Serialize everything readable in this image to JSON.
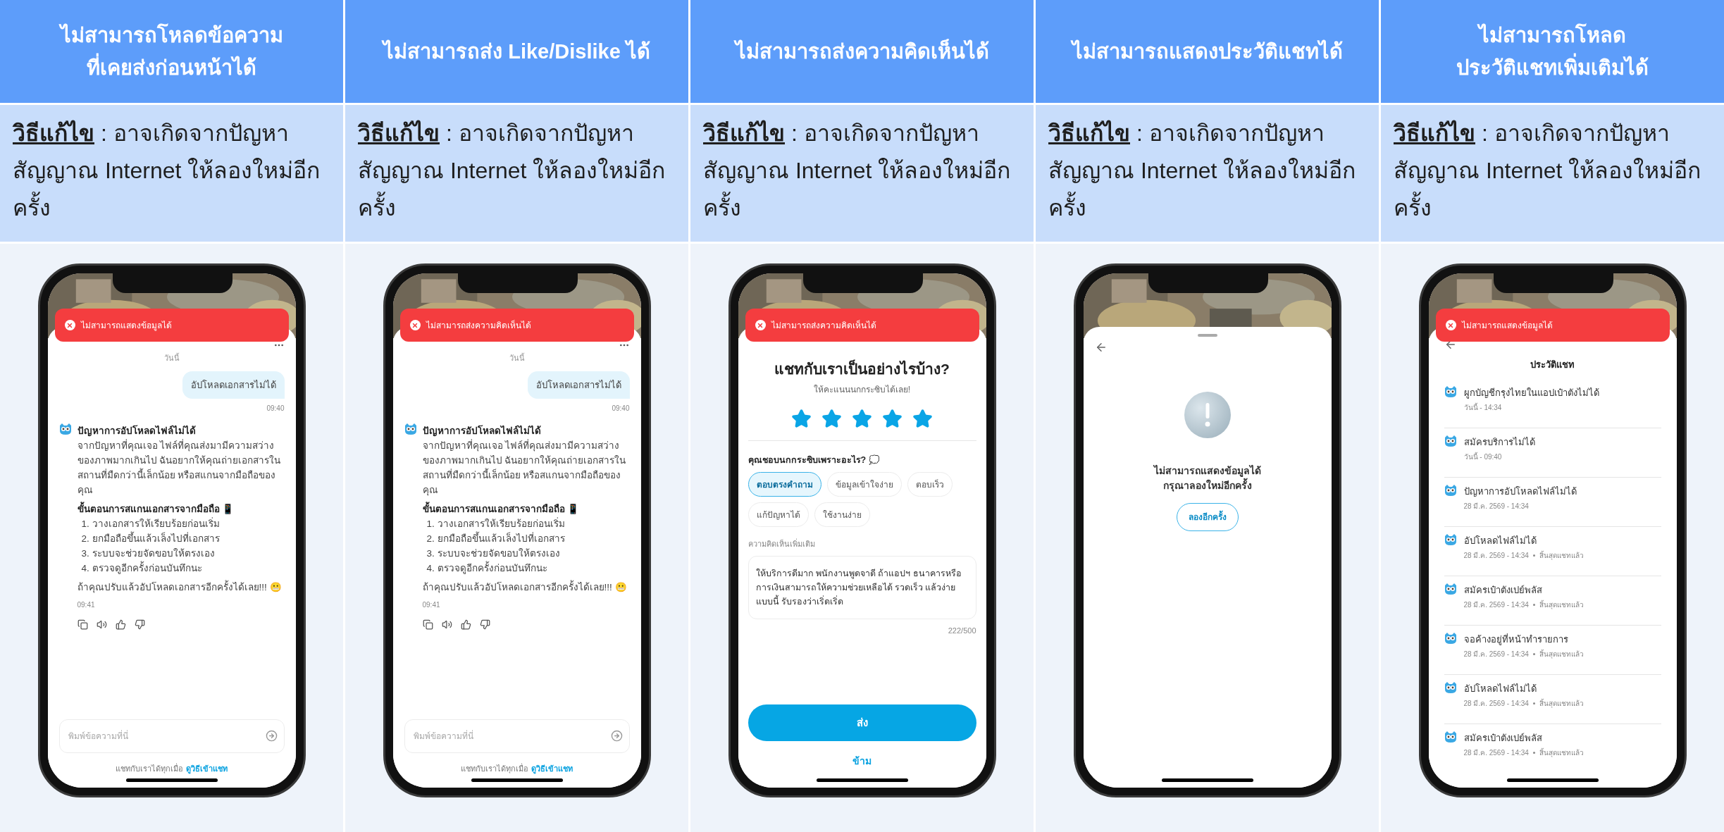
{
  "columns": [
    {
      "title": [
        "ไม่สามารถโหลดข้อความ",
        "ที่เคยส่งก่อนหน้าได้"
      ],
      "fix": {
        "label": "วิธีแก้ไข",
        "text": " : อาจเกิดจากปัญหาสัญญาณ Internet ให้ลองใหม่อีกครั้ง"
      },
      "phone": {
        "kind": "chat",
        "toast": "ไม่สามารถแสดงข้อมูลได้",
        "date": "วันนี้",
        "user_message": "อัปโหลดเอกสารไม่ได้",
        "user_time": "09:40",
        "bot_title": "ปัญหาการอัปโหลดไฟล์ไม่ได้",
        "bot_body": "จากปัญหาที่คุณเจอ ไฟล์ที่คุณส่งมามีความสว่างของภาพมากเกินไป ฉันอยากให้คุณถ่ายเอกสารในสถานที่มืดกว่านี้เล็กน้อย หรือสแกนจากมือถือของคุณ",
        "steps_title": "ขั้นตอนการสแกนเอกสารจากมือถือ 📱",
        "steps": [
          "1. วางเอกสารให้เรียบร้อยก่อนเริ่ม",
          "2. ยกมือถือขึ้นแล้วเล็งไปที่เอกสาร",
          "3. ระบบจะช่วยจัดขอบให้ตรงเอง",
          "4. ตรวจดูอีกครั้งก่อนบันทึกนะ"
        ],
        "closing": "ถ้าคุณปรับแล้วอัปโหลดเอกสารอีกครั้งได้เลย!!! 😬",
        "bot_time": "09:41",
        "input": {
          "placeholder": "พิมพ์ข้อความที่นี่"
        },
        "footer": "แชทกับเราได้ทุกเมื่อ",
        "footer_link": "ดูวิธีเข้าแชท"
      }
    },
    {
      "title": [
        "ไม่สามารถส่ง Like/Dislike ได้"
      ],
      "fix": {
        "label": "วิธีแก้ไข",
        "text": " : อาจเกิดจากปัญหาสัญญาณ Internet ให้ลองใหม่อีกครั้ง"
      },
      "phone": {
        "kind": "chat",
        "toast": "ไม่สามารถส่งความคิดเห็นได้",
        "date": "วันนี้",
        "user_message": "อัปโหลดเอกสารไม่ได้",
        "user_time": "09:40",
        "bot_title": "ปัญหาการอัปโหลดไฟล์ไม่ได้",
        "bot_body": "จากปัญหาที่คุณเจอ ไฟล์ที่คุณส่งมามีความสว่างของภาพมากเกินไป ฉันอยากให้คุณถ่ายเอกสารในสถานที่มืดกว่านี้เล็กน้อย หรือสแกนจากมือถือของคุณ",
        "steps_title": "ขั้นตอนการสแกนเอกสารจากมือถือ 📱",
        "steps": [
          "1. วางเอกสารให้เรียบร้อยก่อนเริ่ม",
          "2. ยกมือถือขึ้นแล้วเล็งไปที่เอกสาร",
          "3. ระบบจะช่วยจัดขอบให้ตรงเอง",
          "4. ตรวจดูอีกครั้งก่อนบันทึกนะ"
        ],
        "closing": "ถ้าคุณปรับแล้วอัปโหลดเอกสารอีกครั้งได้เลย!!! 😬",
        "bot_time": "09:41",
        "input": {
          "placeholder": "พิมพ์ข้อความที่นี่"
        },
        "footer": "แชทกับเราได้ทุกเมื่อ",
        "footer_link": "ดูวิธีเข้าแชท"
      }
    },
    {
      "title": [
        "ไม่สามารถส่งความคิดเห็นได้"
      ],
      "fix": {
        "label": "วิธีแก้ไข",
        "text": " : อาจเกิดจากปัญหาสัญญาณ Internet ให้ลองใหม่อีกครั้ง"
      },
      "phone": {
        "kind": "feedback",
        "toast": "ไม่สามารถส่งความคิดเห็นได้",
        "heading": "แชทกับเราเป็นอย่างไรบ้าง?",
        "subheading": "ให้คะแนนนกกระซิบได้เลย!",
        "stars": 5,
        "question": "คุณชอบนกกระซิบเพราะอะไร? 💭",
        "chips": [
          {
            "label": "ตอบตรงคำถาม",
            "selected": true
          },
          {
            "label": "ข้อมูลเข้าใจง่าย",
            "selected": false
          },
          {
            "label": "ตอบเร็ว",
            "selected": false
          },
          {
            "label": "แก้ปัญหาได้",
            "selected": false
          },
          {
            "label": "ใช้งานง่าย",
            "selected": false
          }
        ],
        "comment_label": "ความคิดเห็นเพิ่มเติม",
        "comment": "ให้บริการดีมาก พนักงานพูดจาดี ถ้าแอปฯ ธนาคารหรือการเงินสามารถให้ความช่วยเหลือได้ รวดเร็ว แล้วง่ายแบบนี้ รับรองว่าเริ่ดเริ่ด",
        "counter": "222/500",
        "submit": "ส่ง",
        "skip": "ข้าม"
      }
    },
    {
      "title": [
        "ไม่สามารถแสดงประวัติแชทได้"
      ],
      "fix": {
        "label": "วิธีแก้ไข",
        "text": " : อาจเกิดจากปัญหาสัญญาณ Internet ให้ลองใหม่อีกครั้ง"
      },
      "phone": {
        "kind": "error",
        "message": [
          "ไม่สามารถแสดงข้อมูลได้",
          "กรุณาลองใหม่อีกครั้ง"
        ],
        "retry": "ลองอีกครั้ง"
      }
    },
    {
      "title": [
        "ไม่สามารถโหลด",
        "ประวัติแชทเพิ่มเติมได้"
      ],
      "fix": {
        "label": "วิธีแก้ไข",
        "text": " : อาจเกิดจากปัญหาสัญญาณ Internet ให้ลองใหม่อีกครั้ง"
      },
      "phone": {
        "kind": "history",
        "toast": "ไม่สามารถแสดงข้อมูลได้",
        "heading": "ประวัติแชท",
        "items": [
          {
            "title": "ผูกบัญชีกรุงไทยในแอปเป๋าตังไม่ได้",
            "date": "วันนี้ - 14:34"
          },
          {
            "title": "สมัครบริการไม่ได้",
            "date": "วันนี้ - 09:40"
          },
          {
            "title": "ปัญหาการอัปโหลดไฟล์ไม่ได้",
            "date": "28 มี.ค. 2569 - 14:34"
          },
          {
            "title": "อัปโหลดไฟล์ไม่ได้",
            "date": "28 มี.ค. 2569 - 14:34",
            "status": "สิ้นสุดแชทแล้ว"
          },
          {
            "title": "สมัครเป๋าตังเปย์พลัส",
            "date": "28 มี.ค. 2569 - 14:34",
            "status": "สิ้นสุดแชทแล้ว"
          },
          {
            "title": "จอค้างอยู่ที่หน้าทำรายการ",
            "date": "28 มี.ค. 2569 - 14:34",
            "status": "สิ้นสุดแชทแล้ว"
          },
          {
            "title": "อัปโหลดไฟล์ไม่ได้",
            "date": "28 มี.ค. 2569 - 14:34",
            "status": "สิ้นสุดแชทแล้ว"
          },
          {
            "title": "สมัครเป๋าตังเปย์พลัส",
            "date": "28 มี.ค. 2569 - 14:34",
            "status": "สิ้นสุดแชทแล้ว"
          }
        ]
      }
    }
  ]
}
